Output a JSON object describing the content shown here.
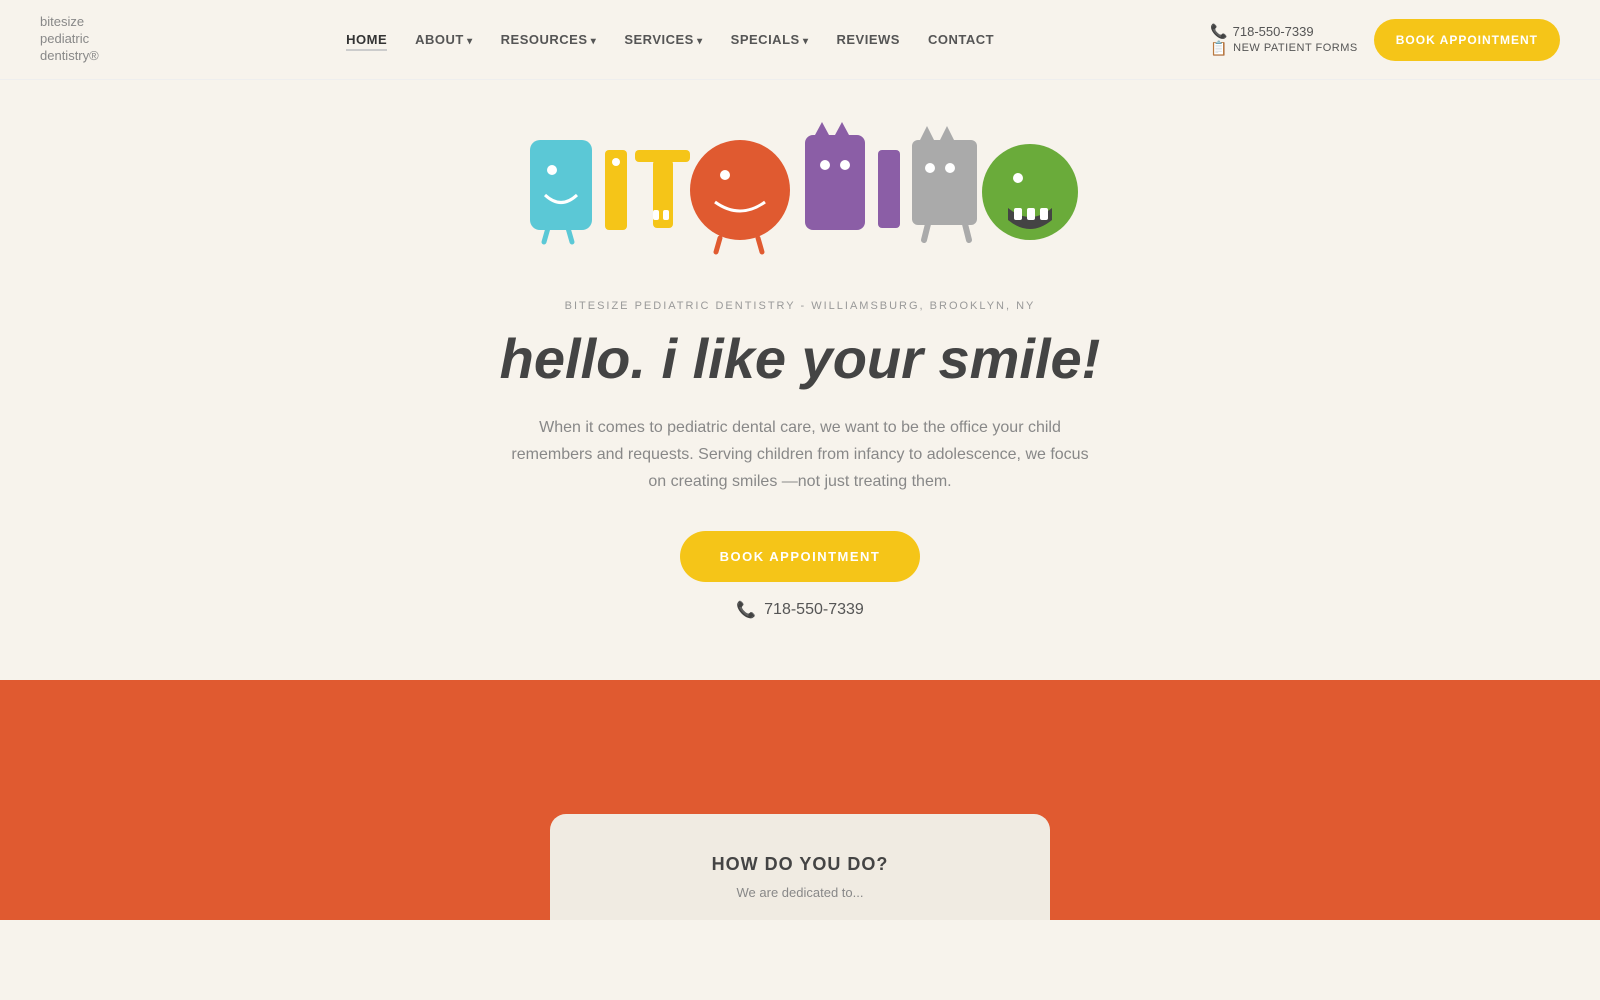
{
  "brand": {
    "name": "bitesize\npediatric\ndentistry®"
  },
  "nav": {
    "links": [
      {
        "label": "HOME",
        "active": true,
        "hasDropdown": false
      },
      {
        "label": "ABOUT",
        "active": false,
        "hasDropdown": true
      },
      {
        "label": "RESOURCES",
        "active": false,
        "hasDropdown": true
      },
      {
        "label": "SERVICES",
        "active": false,
        "hasDropdown": true
      },
      {
        "label": "SPECIALS",
        "active": false,
        "hasDropdown": true
      },
      {
        "label": "REVIEWS",
        "active": false,
        "hasDropdown": false
      },
      {
        "label": "CONTACT",
        "active": false,
        "hasDropdown": false
      }
    ],
    "phone": "718-550-7339",
    "forms_label": "NEW PATIENT FORMS",
    "book_label": "BOOK APPOINTMENT"
  },
  "hero": {
    "subtitle": "BITESIZE PEDIATRIC DENTISTRY - WILLIAMSBURG, BROOKLYN, NY",
    "title": "hello. i like your smile!",
    "description": "When it comes to pediatric dental care, we want to be the office your child remembers and requests. Serving children from infancy to adolescence, we focus on creating smiles —not just treating them.",
    "book_label": "BOOK APPOINTMENT",
    "phone": "718-550-7339"
  },
  "how_card": {
    "title": "HOW DO YOU DO?",
    "text": "We are dedicated to..."
  },
  "colors": {
    "yellow": "#f5c518",
    "orange": "#e05a30",
    "green": "#6aab3a",
    "purple": "#8b5ea6",
    "teal": "#5bc8d6",
    "tan": "#f7f3ec"
  }
}
